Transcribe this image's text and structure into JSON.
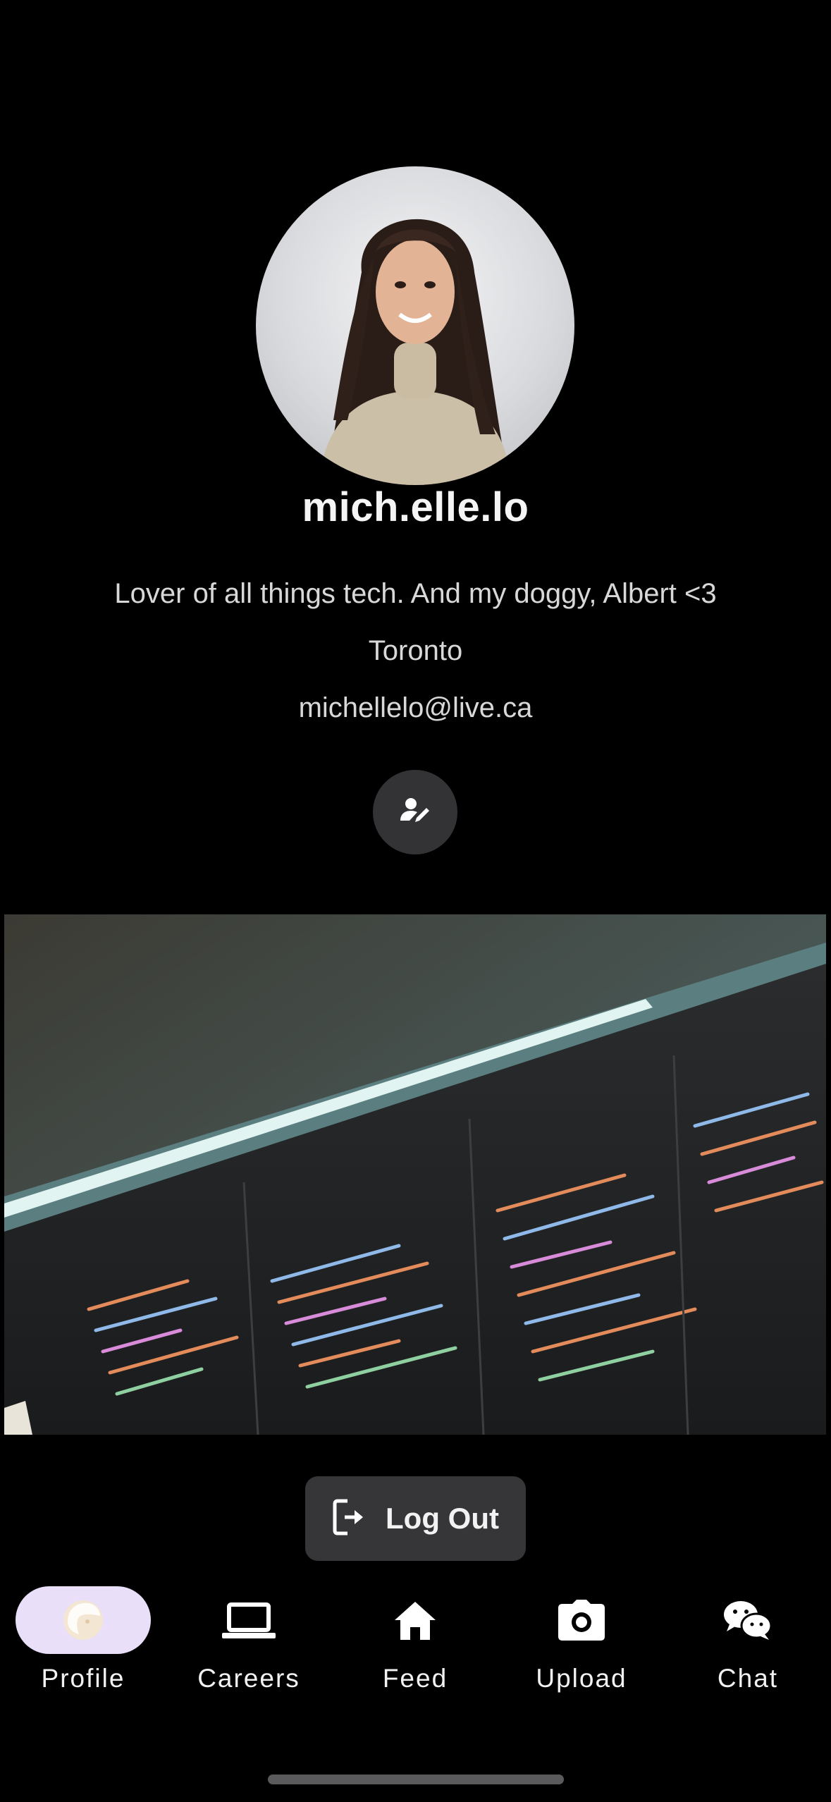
{
  "profile": {
    "username": "mich.elle.lo",
    "bio": "Lover of all things tech. And my doggy, Albert <3",
    "location": "Toronto",
    "email": "michellelo@live.ca",
    "edit_icon": "edit-person-icon"
  },
  "post": {
    "image_icon": "photo-of-code-on-monitor"
  },
  "actions": {
    "logout_label": "Log Out",
    "logout_icon": "logout-icon"
  },
  "tabbar": {
    "tabs": [
      {
        "label": "Profile",
        "icon": "profile-icon",
        "active": true
      },
      {
        "label": "Careers",
        "icon": "laptop-icon",
        "active": false
      },
      {
        "label": "Feed",
        "icon": "home-icon",
        "active": false
      },
      {
        "label": "Upload",
        "icon": "camera-icon",
        "active": false
      },
      {
        "label": "Chat",
        "icon": "wechat-icon",
        "active": false
      }
    ]
  },
  "colors": {
    "background": "#000000",
    "active_tab_pill": "#e9dff9",
    "button_bg": "#363638",
    "text": "#f2f2f2"
  }
}
